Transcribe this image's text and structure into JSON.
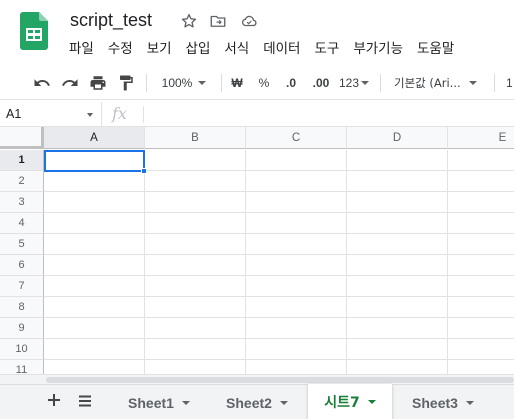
{
  "app": {
    "doc_title": "script_test"
  },
  "menu": [
    "파일",
    "수정",
    "보기",
    "삽입",
    "서식",
    "데이터",
    "도구",
    "부가기능",
    "도움말"
  ],
  "toolbar": {
    "zoom": "100%",
    "currency": "₩",
    "percent": "%",
    "decrease_decimal": ".0",
    "increase_decimal": ".00",
    "number_format": "123",
    "font": "기본값 (Ari...",
    "font_size": "1"
  },
  "formula_bar": {
    "cell_ref": "A1",
    "fx": "fx"
  },
  "grid": {
    "columns": [
      "A",
      "B",
      "C",
      "D",
      "E"
    ],
    "rows": [
      "1",
      "2",
      "3",
      "4",
      "5",
      "6",
      "7",
      "8",
      "9",
      "10",
      "11"
    ],
    "active_cell": "A1"
  },
  "sheets": {
    "tabs": [
      {
        "label": "Sheet1",
        "active": false
      },
      {
        "label": "Sheet2",
        "active": false
      },
      {
        "label": "시트7",
        "active": true
      },
      {
        "label": "Sheet3",
        "active": false
      }
    ]
  },
  "colors": {
    "accent_blue": "#1a73e8",
    "sheets_green": "#188038",
    "logo_green": "#23a566"
  }
}
